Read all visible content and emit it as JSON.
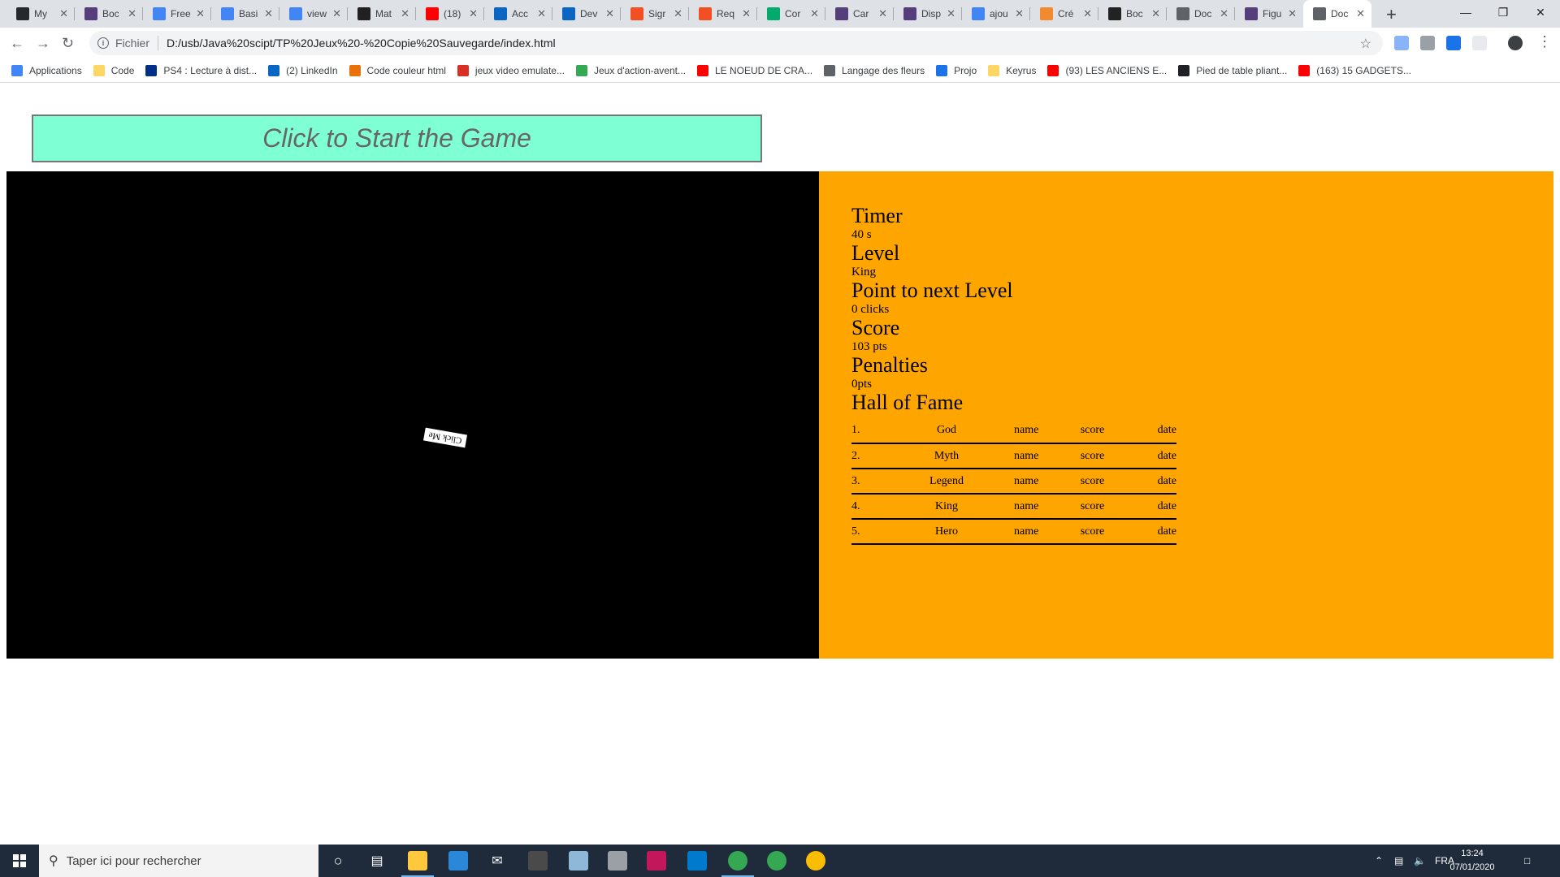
{
  "browser": {
    "tabs": [
      {
        "label": "My",
        "icon": "github-icon",
        "color": "#24292e"
      },
      {
        "label": "Boc",
        "icon": "bootstrap-icon",
        "color": "#563d7c"
      },
      {
        "label": "Free",
        "icon": "code-icon",
        "color": "#4285f4"
      },
      {
        "label": "Basi",
        "icon": "code-icon",
        "color": "#4285f4"
      },
      {
        "label": "view",
        "icon": "code-icon",
        "color": "#4285f4"
      },
      {
        "label": "Mat",
        "icon": "material-icon",
        "color": "#212121"
      },
      {
        "label": "(18)",
        "icon": "youtube-icon",
        "color": "#ff0000"
      },
      {
        "label": "Acc",
        "icon": "linkedin-icon",
        "color": "#0a66c2"
      },
      {
        "label": "Dev",
        "icon": "linkedin-icon",
        "color": "#0a66c2"
      },
      {
        "label": "Sigr",
        "icon": "microsoft-icon",
        "color": "#f25022"
      },
      {
        "label": "Req",
        "icon": "microsoft-icon",
        "color": "#f25022"
      },
      {
        "label": "Cor",
        "icon": "w3schools-icon",
        "color": "#04aa6d"
      },
      {
        "label": "Car",
        "icon": "bootstrap-icon",
        "color": "#563d7c"
      },
      {
        "label": "Disp",
        "icon": "bootstrap-icon",
        "color": "#563d7c"
      },
      {
        "label": "ajou",
        "icon": "google-icon",
        "color": "#4285f4"
      },
      {
        "label": "Cré",
        "icon": "tool-icon",
        "color": "#f28b30"
      },
      {
        "label": "Boc",
        "icon": "bootstrap-icon",
        "color": "#222222"
      },
      {
        "label": "Doc",
        "icon": "globe-icon",
        "color": "#5f6368"
      },
      {
        "label": "Figu",
        "icon": "bootstrap-icon",
        "color": "#563d7c"
      },
      {
        "label": "Doc",
        "icon": "globe-icon",
        "color": "#5f6368"
      }
    ],
    "new_tab": "+",
    "address": {
      "scheme": "Fichier",
      "url": "D:/usb/Java%20scipt/TP%20Jeux%20-%20Copie%20Sauvegarde/index.html"
    },
    "bookmarks": [
      {
        "label": "Applications",
        "color": "#4285f4"
      },
      {
        "label": "Code",
        "color": "#fdd663"
      },
      {
        "label": "PS4 : Lecture à dist...",
        "color": "#003087"
      },
      {
        "label": "(2) LinkedIn",
        "color": "#0a66c2"
      },
      {
        "label": "Code couleur html",
        "color": "#e8710a"
      },
      {
        "label": "jeux video emulate...",
        "color": "#d93025"
      },
      {
        "label": "Jeux d'action-avent...",
        "color": "#34a853"
      },
      {
        "label": "LE NOEUD DE CRA...",
        "color": "#ff0000"
      },
      {
        "label": "Langage des fleurs",
        "color": "#5f6368"
      },
      {
        "label": "Projo",
        "color": "#1a73e8"
      },
      {
        "label": "Keyrus",
        "color": "#fdd663"
      },
      {
        "label": "(93) LES ANCIENS E...",
        "color": "#ff0000"
      },
      {
        "label": "Pied de table pliant...",
        "color": "#202124"
      },
      {
        "label": "(163) 15 GADGETS...",
        "color": "#ff0000"
      }
    ]
  },
  "page": {
    "start_button": "Click to Start the Game",
    "target_label": "Click Me",
    "stats": [
      {
        "title": "Timer",
        "value": "40 s"
      },
      {
        "title": "Level",
        "value": "King"
      },
      {
        "title": "Point to next Level",
        "value": "0 clicks"
      },
      {
        "title": "Score",
        "value": "103 pts"
      },
      {
        "title": "Penalties",
        "value": "0pts"
      }
    ],
    "hall_of_fame": {
      "title": "Hall of Fame",
      "rows": [
        {
          "rank": "1.",
          "tier": "God",
          "name": "name",
          "score": "score",
          "date": "date"
        },
        {
          "rank": "2.",
          "tier": "Myth",
          "name": "name",
          "score": "score",
          "date": "date"
        },
        {
          "rank": "3.",
          "tier": "Legend",
          "name": "name",
          "score": "score",
          "date": "date"
        },
        {
          "rank": "4.",
          "tier": "King",
          "name": "name",
          "score": "score",
          "date": "date"
        },
        {
          "rank": "5.",
          "tier": "Hero",
          "name": "name",
          "score": "score",
          "date": "date"
        }
      ]
    },
    "colors": {
      "start_button_bg": "#7fffd4",
      "game_area_bg": "#000000",
      "side_panel_bg": "#ffa500"
    }
  },
  "taskbar": {
    "search_placeholder": "Taper ici pour rechercher",
    "language": "FRA",
    "time": "13:24",
    "date": "07/01/2020"
  }
}
